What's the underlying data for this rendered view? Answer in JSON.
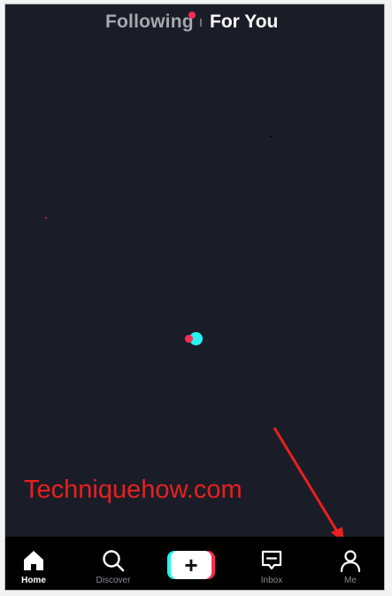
{
  "header": {
    "tab_following": "Following",
    "tab_for_you": "For You"
  },
  "watermark": "Techniquehow.com",
  "bottom_nav": {
    "items": [
      {
        "label": "Home",
        "icon": "home-icon",
        "active": true
      },
      {
        "label": "Discover",
        "icon": "search-icon",
        "active": false
      },
      {
        "label": "",
        "icon": "plus-icon",
        "active": false
      },
      {
        "label": "Inbox",
        "icon": "inbox-icon",
        "active": false
      },
      {
        "label": "Me",
        "icon": "profile-icon",
        "active": false
      }
    ]
  },
  "colors": {
    "background": "#1a1d27",
    "accent_red": "#fe2c55",
    "accent_cyan": "#25f4ee",
    "nav_background": "#000000",
    "watermark": "#e8201f"
  }
}
